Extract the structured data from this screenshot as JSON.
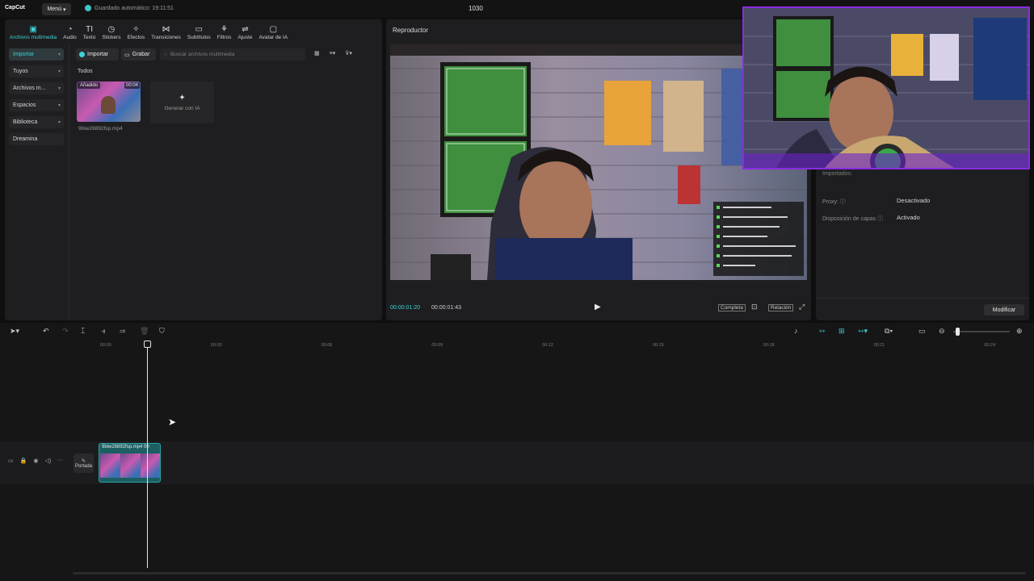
{
  "app": {
    "logo": "CapCut",
    "menu_label": "Menú",
    "autosave": "Guardado automático: 19:11:51",
    "project_title": "1030"
  },
  "tool_tabs": [
    {
      "label": "Archivos multimedia",
      "icon": "▣",
      "active": true
    },
    {
      "label": "Audio",
      "icon": "◔"
    },
    {
      "label": "Texto",
      "icon": "TI"
    },
    {
      "label": "Stickers",
      "icon": "◷"
    },
    {
      "label": "Efectos",
      "icon": "✧"
    },
    {
      "label": "Transiciones",
      "icon": "⋈"
    },
    {
      "label": "Subtítulos",
      "icon": "▭"
    },
    {
      "label": "Filtros",
      "icon": "⚘"
    },
    {
      "label": "Ajuste",
      "icon": "⇌"
    },
    {
      "label": "Avatar de IA",
      "icon": "▢"
    }
  ],
  "side_nav": [
    {
      "label": "Importar",
      "active": true,
      "chevron": true
    },
    {
      "label": "Tuyos",
      "chevron": true
    },
    {
      "label": "Archivos m...",
      "chevron": true
    },
    {
      "label": "Espacios",
      "chevron": true
    },
    {
      "label": "Biblioteca",
      "chevron": true
    },
    {
      "label": "Dreamina",
      "chevron": false
    }
  ],
  "media": {
    "import_label": "Importar",
    "record_label": "Grabar",
    "search_placeholder": "Buscar archivos multimedia",
    "all_label": "Todos",
    "thumb_added": "Añadido",
    "thumb_duration": "00:04",
    "thumb_name": "9biw28892fsp.mp4",
    "generate_ai": "Generar con IA"
  },
  "player": {
    "title": "Reproductor",
    "current_time": "00:00:01:20",
    "total_time": "00:00:01:43",
    "full_label": "Completa",
    "ratio_label": "Relación"
  },
  "details": {
    "imported_label": "Importados:",
    "proxy_label": "Proxy:",
    "proxy_value": "Desactivado",
    "layers_label": "Disposición de capas",
    "layers_value": "Activado",
    "modify_label": "Modificar"
  },
  "timeline": {
    "ticks": [
      "00:00",
      "00:03",
      "00:06",
      "00:09",
      "00:12",
      "00:15",
      "00:18",
      "00:21",
      "00:24"
    ],
    "clip_label": "9biw28892fsp.mp4",
    "clip_duration": "00",
    "cover_label": "Portada"
  },
  "colors": {
    "accent": "#3ed2d4",
    "webcam_border": "#8a2be2"
  }
}
